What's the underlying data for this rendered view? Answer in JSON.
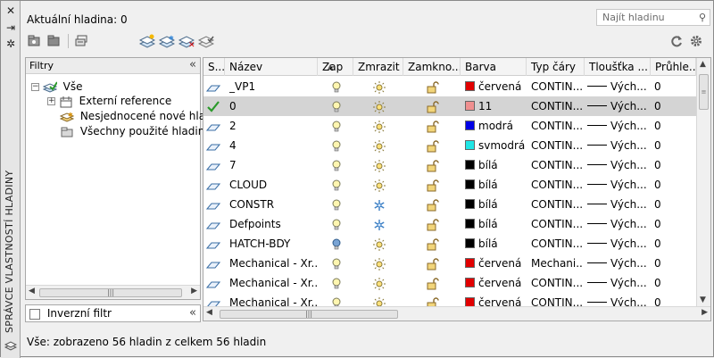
{
  "palette": {
    "panel_title": "SPRÁVCE VLASTNOSTÍ HLADINY"
  },
  "header": {
    "current_layer": "Aktuální hladina: 0",
    "search_placeholder": "Najít hladinu"
  },
  "filters": {
    "title": "Filtry",
    "tree": [
      {
        "label": "Vše"
      },
      {
        "label": "Externí reference"
      },
      {
        "label": "Nesjednocené nové hladiny"
      },
      {
        "label": "Všechny použité hladiny"
      }
    ],
    "invert_label": "Inverzní filtr"
  },
  "table": {
    "columns": [
      "S...",
      "Název",
      "Zap",
      "Zmrazit",
      "Zamkno...",
      "Barva",
      "Typ čáry",
      "Tloušťka ...",
      "Průhle..."
    ],
    "rows": [
      {
        "name": "_VP1",
        "on": true,
        "frozen": false,
        "color_name": "červená",
        "color": "#e10000",
        "linetype": "CONTIN...",
        "lineweight": "Vých...",
        "transparency": "0"
      },
      {
        "name": "0",
        "on": true,
        "frozen": false,
        "color_name": "11",
        "color": "#ef8f8f",
        "linetype": "CONTIN...",
        "lineweight": "Vých...",
        "transparency": "0",
        "current": true
      },
      {
        "name": "2",
        "on": true,
        "frozen": false,
        "color_name": "modrá",
        "color": "#0000e6",
        "linetype": "CONTIN...",
        "lineweight": "Vých...",
        "transparency": "0"
      },
      {
        "name": "4",
        "on": true,
        "frozen": false,
        "color_name": "svmodrá",
        "color": "#20e6e6",
        "linetype": "CONTIN...",
        "lineweight": "Vých...",
        "transparency": "0"
      },
      {
        "name": "7",
        "on": true,
        "frozen": false,
        "color_name": "bílá",
        "color": "#000000",
        "linetype": "CONTIN...",
        "lineweight": "Vých...",
        "transparency": "0"
      },
      {
        "name": "CLOUD",
        "on": true,
        "frozen": false,
        "color_name": "bílá",
        "color": "#000000",
        "linetype": "CONTIN...",
        "lineweight": "Vých...",
        "transparency": "0"
      },
      {
        "name": "CONSTR",
        "on": true,
        "frozen": true,
        "color_name": "bílá",
        "color": "#000000",
        "linetype": "CONTIN...",
        "lineweight": "Vých...",
        "transparency": "0"
      },
      {
        "name": "Defpoints",
        "on": true,
        "frozen": true,
        "color_name": "bílá",
        "color": "#000000",
        "linetype": "CONTIN...",
        "lineweight": "Vých...",
        "transparency": "0"
      },
      {
        "name": "HATCH-BDY",
        "on": false,
        "frozen": false,
        "color_name": "bílá",
        "color": "#000000",
        "linetype": "CONTIN...",
        "lineweight": "Vých...",
        "transparency": "0"
      },
      {
        "name": "Mechanical - Xr...",
        "on": true,
        "frozen": false,
        "color_name": "červená",
        "color": "#e10000",
        "linetype": "Mechani...",
        "lineweight": "Vých...",
        "transparency": "0"
      },
      {
        "name": "Mechanical - Xr...",
        "on": true,
        "frozen": false,
        "color_name": "červená",
        "color": "#e10000",
        "linetype": "CONTIN...",
        "lineweight": "Vých...",
        "transparency": "0"
      },
      {
        "name": "Mechanical - Xr...",
        "on": true,
        "frozen": false,
        "color_name": "červená",
        "color": "#e10000",
        "linetype": "CONTIN...",
        "lineweight": "Vých...",
        "transparency": "0"
      }
    ]
  },
  "status": "Vše: zobrazeno 56 hladin z celkem 56 hladin"
}
